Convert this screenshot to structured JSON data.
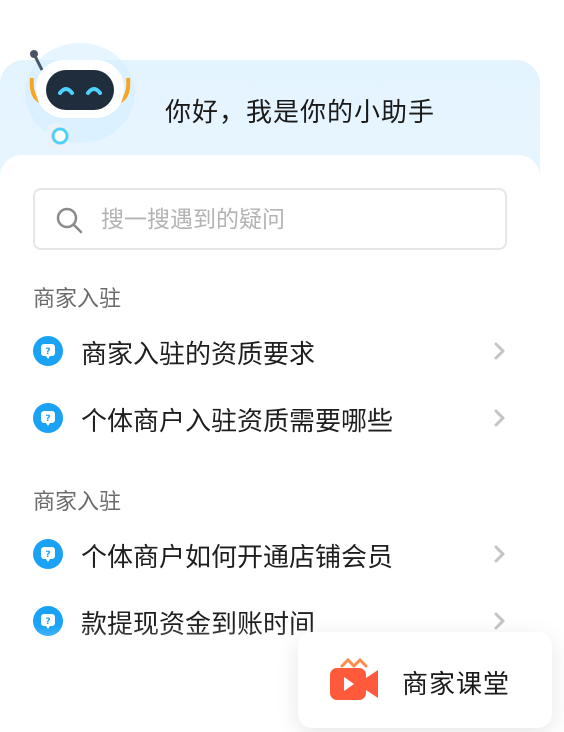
{
  "header": {
    "greeting": "你好，我是你的小助手",
    "mascot_icon": "robot-mascot-icon"
  },
  "search": {
    "placeholder": "搜一搜遇到的疑问",
    "value": "",
    "icon": "search-icon"
  },
  "sections": [
    {
      "title": "商家入驻",
      "items": [
        "商家入驻的资质要求",
        "个体商户入驻资质需要哪些"
      ]
    },
    {
      "title": "商家入驻",
      "items": [
        "个体商户如何开通店铺会员",
        "款提现资金到账时间"
      ]
    }
  ],
  "floating_button": {
    "label": "商家课堂",
    "icon": "video-camera-icon"
  },
  "colors": {
    "accent": "#1aa3f5",
    "chevron": "#c4c4c4",
    "camera": "#ff5a3c"
  }
}
